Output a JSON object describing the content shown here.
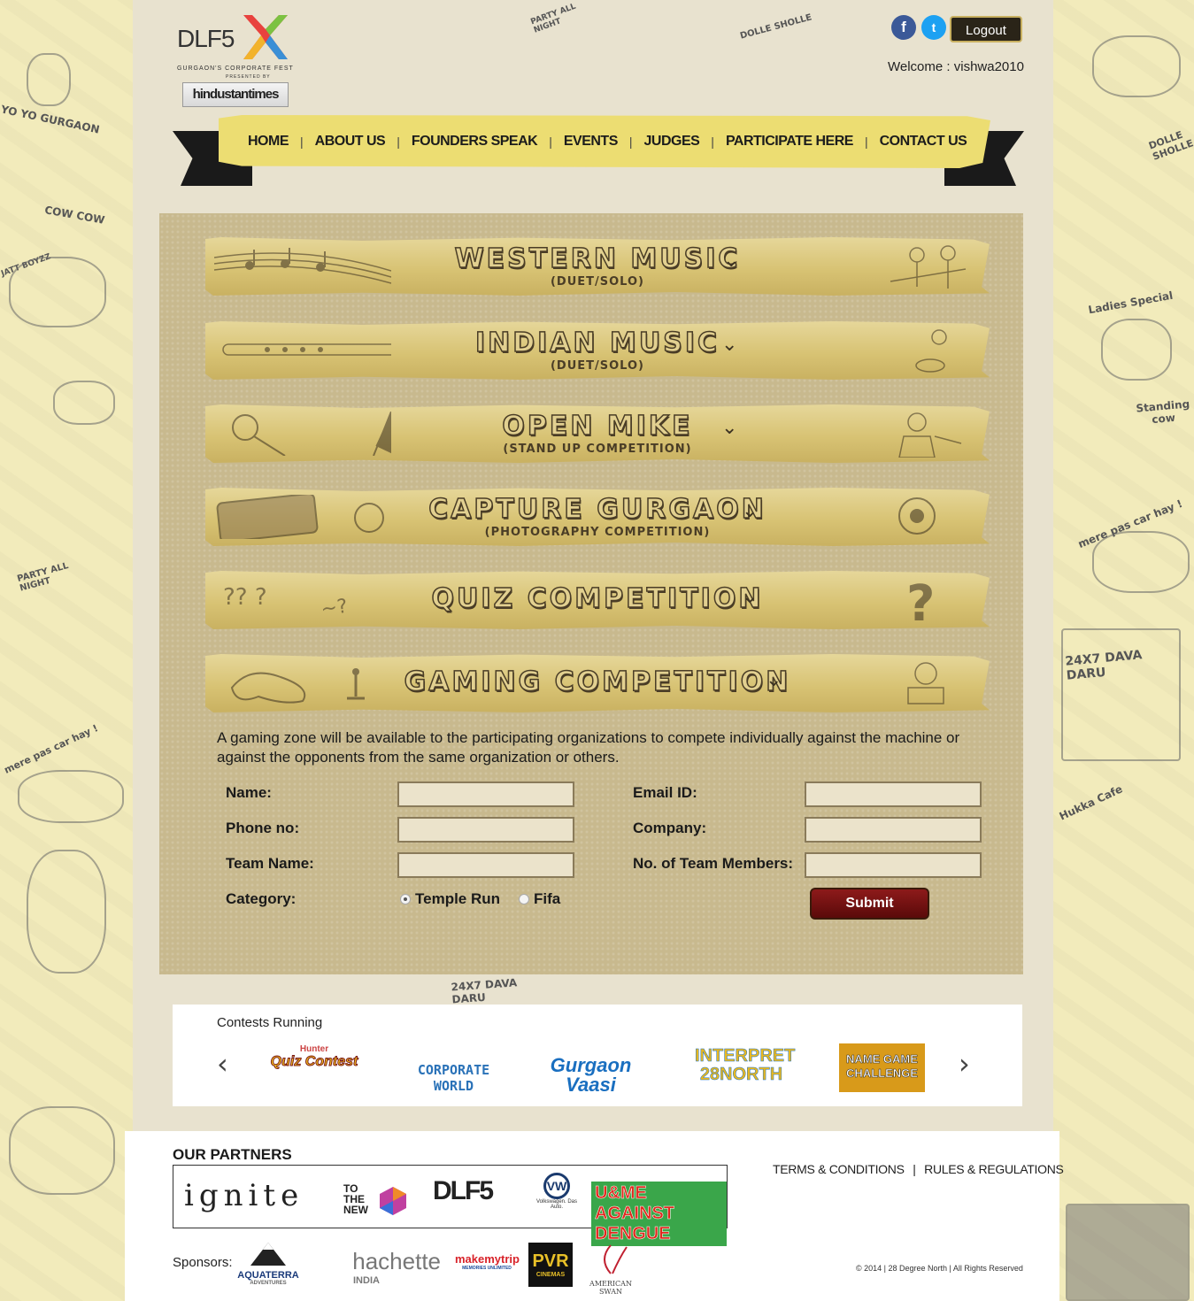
{
  "header": {
    "logo_text": "DLF5",
    "logo_subtitle": "GURGAON'S CORPORATE FEST",
    "presented_by": "PRESENTED BY",
    "sponsor_logo": "hindustantimes",
    "facebook_icon": "f",
    "twitter_icon": "t",
    "logout_label": "Logout",
    "welcome": "Welcome : vishwa2010"
  },
  "nav": {
    "items": [
      "HOME",
      "ABOUT US",
      "FOUNDERS SPEAK",
      "EVENTS",
      "JUDGES",
      "PARTICIPATE HERE",
      "CONTACT US"
    ],
    "separator": "|"
  },
  "events": [
    {
      "title": "WESTERN MUSIC",
      "subtitle": "(DUET/SOLO)"
    },
    {
      "title": "INDIAN MUSIC",
      "subtitle": "(DUET/SOLO)"
    },
    {
      "title": "OPEN MIKE",
      "subtitle": "(STAND UP COMPETITION)"
    },
    {
      "title": "CAPTURE GURGAON",
      "subtitle": "(PHOTOGRAPHY COMPETITION)"
    },
    {
      "title": "QUIZ COMPETITION",
      "subtitle": ""
    },
    {
      "title": "GAMING COMPETITION",
      "subtitle": ""
    }
  ],
  "chevron": "⌄",
  "gaming": {
    "description": "A gaming zone will be available to the participating organizations to compete individually against the machine or against the opponents from the same organization or others.",
    "form": {
      "name_label": "Name:",
      "name_value": "",
      "phone_label": "Phone no:",
      "phone_value": "",
      "team_label": "Team Name:",
      "team_value": "",
      "email_label": "Email ID:",
      "email_value": "",
      "company_label": "Company:",
      "company_value": "",
      "members_label": "No. of Team Members:",
      "members_value": "",
      "category_label": "Category:",
      "options": [
        "Temple Run",
        "Fifa"
      ],
      "selected": "Temple Run",
      "submit_label": "Submit"
    }
  },
  "contests": {
    "title": "Contests Running",
    "prev": "‹",
    "next": "›",
    "items": [
      "Quiz Contest",
      "CORPORATE WORLD",
      "Gurgaon Vaasi",
      "INTERPRET 28NORTH",
      "NAME GAME CHALLENGE"
    ],
    "quiz_small": "Hunter"
  },
  "footer": {
    "partners_title": "OUR PARTNERS",
    "partners": [
      "ignite",
      "TO THE NEW",
      "DLF5",
      "Volkswagen. Das Auto.",
      "U&ME AGAINST DENGUE"
    ],
    "terms": "TERMS & CONDITIONS",
    "rules": "RULES & REGULATIONS",
    "sponsors_label": "Sponsors:",
    "sponsors": [
      "AQUATERRA",
      "hachette",
      "makemytrip",
      "PVR",
      "AMERICAN SWAN"
    ],
    "sponsor_subs": [
      "ADVENTURES",
      "INDIA",
      "MEMORIES UNLIMITED",
      "CINEMAS",
      ""
    ],
    "copyright": "© 2014 | 28 Degree North | All Rights Reserved"
  },
  "doodles": {
    "left": [
      "YO YO GURGAON",
      "COW COW",
      "JATT BOYZZ",
      "PARTY ALL NIGHT",
      "mere pas car hay !"
    ],
    "right": [
      "DOLLE SHOLLE",
      "Ladies Special",
      "Standing cow",
      "mere pas car hay !",
      "24X7 DAVA DARU",
      "Hukka Cafe"
    ],
    "top": [
      "PARTY ALL NIGHT",
      "DOLLE SHOLLE"
    ],
    "bottom": "24X7 DAVA DARU"
  },
  "colors": {
    "nav_ribbon": "#ecdd72",
    "event_bar": "#d8c374",
    "panel": "#c8b98e",
    "submit": "#7a1212",
    "facebook": "#3b5998",
    "twitter": "#1da1f2"
  }
}
